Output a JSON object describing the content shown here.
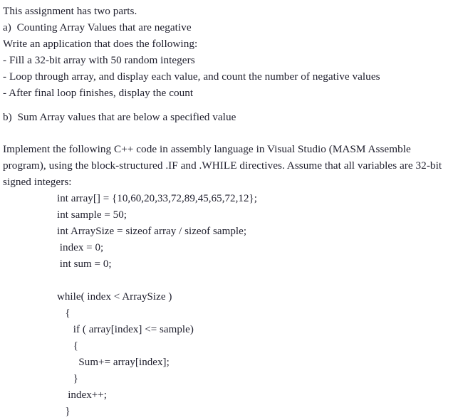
{
  "document": {
    "intro_lines": [
      "This assignment has two parts.",
      "a)  Counting Array Values that are negative",
      "Write an application that does the following:",
      "- Fill a 32-bit array with 50 random integers",
      "- Loop through array, and display each value, and count the number of negative values",
      "- After final loop finishes, display the count"
    ],
    "part_b_heading": "b)  Sum Array values that are below a specified value",
    "instruction_paragraph": "Implement the following C++ code in assembly language in Visual Studio (MASM Assemble program), using the block-structured .IF and .WHILE directives. Assume that all variables are 32-bit signed integers:",
    "code_lines": [
      "int array[] = {10,60,20,33,72,89,45,65,72,12};",
      "int sample = 50;",
      "int ArraySize = sizeof array / sizeof sample;",
      " index = 0;",
      " int sum = 0;",
      "",
      "while( index < ArraySize )",
      "   {",
      "      if ( array[index] <= sample)",
      "      {",
      "        Sum+= array[index];",
      "      }",
      "    index++;",
      "   }"
    ],
    "code_meta": {
      "language": "C++",
      "array_values": [
        10,
        60,
        20,
        33,
        72,
        89,
        45,
        65,
        72,
        12
      ],
      "sample_value": 50,
      "index_init": 0,
      "sum_init": 0
    },
    "colors": {
      "background": "#ffffff",
      "text": "#20202e"
    }
  }
}
